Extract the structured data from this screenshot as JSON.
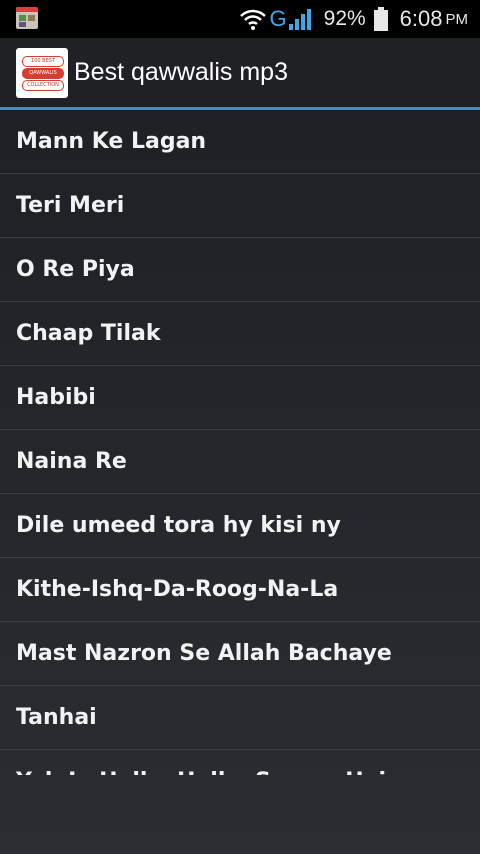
{
  "status_bar": {
    "network_type": "G",
    "battery_percent": "92%",
    "time": "6:08",
    "ampm": "PM",
    "icons": [
      "notification-icon",
      "wifi-icon",
      "signal-icon",
      "battery-icon"
    ]
  },
  "action_bar": {
    "title": "Best qawwalis mp3",
    "logo_lines": [
      "100 BEST",
      "QAWWALIS",
      "COLLECTION"
    ],
    "accent_color": "#3e8ed0"
  },
  "songs": [
    "Mann Ke Lagan",
    "Teri Meri",
    "O Re Piya",
    "Chaap Tilak",
    "Habibi",
    "Naina Re",
    "Dile umeed tora hy kisi ny",
    "Kithe-Ishq-Da-Roog-Na-La",
    "Mast Nazron Se Allah Bachaye",
    "Tanhai",
    "Yeh Jo Halka Halka Saroor Hai"
  ]
}
